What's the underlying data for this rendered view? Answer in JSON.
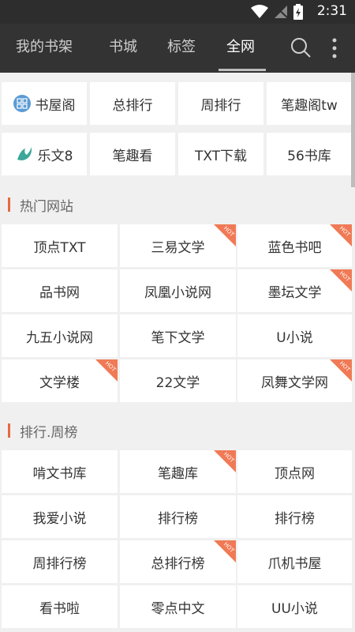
{
  "status_bar": {
    "time": "2:31"
  },
  "tabs": [
    {
      "label": "我的书架"
    },
    {
      "label": "书城"
    },
    {
      "label": "标签"
    },
    {
      "label": "全网"
    }
  ],
  "top_sites": [
    {
      "label": "书屋阁",
      "icon": "grid-circle-icon"
    },
    {
      "label": "总排行"
    },
    {
      "label": "周排行"
    },
    {
      "label": "笔趣阁tw"
    },
    {
      "label": "乐文8",
      "icon": "bird-icon"
    },
    {
      "label": "笔趣看"
    },
    {
      "label": "TXT下载"
    },
    {
      "label": "56书库"
    }
  ],
  "hot_sites": {
    "title": "热门网站",
    "items": [
      {
        "label": "顶点TXT",
        "hot": false
      },
      {
        "label": "三易文学",
        "hot": true
      },
      {
        "label": "蓝色书吧",
        "hot": true
      },
      {
        "label": "品书网",
        "hot": false
      },
      {
        "label": "凤凰小说网",
        "hot": false
      },
      {
        "label": "墨坛文学",
        "hot": true
      },
      {
        "label": "九五小说网",
        "hot": false
      },
      {
        "label": "笔下文学",
        "hot": false
      },
      {
        "label": "U小说",
        "hot": false
      },
      {
        "label": "文学楼",
        "hot": true
      },
      {
        "label": "22文学",
        "hot": false
      },
      {
        "label": "凤舞文学网",
        "hot": true
      }
    ]
  },
  "rank_sites": {
    "title": "排行.周榜",
    "items": [
      {
        "label": "啃文书库",
        "hot": false
      },
      {
        "label": "笔趣库",
        "hot": true
      },
      {
        "label": "顶点网",
        "hot": false
      },
      {
        "label": "我爱小说",
        "hot": false
      },
      {
        "label": "排行榜",
        "hot": false
      },
      {
        "label": "排行榜",
        "hot": false
      },
      {
        "label": "周排行榜",
        "hot": false
      },
      {
        "label": "总排行榜",
        "hot": true
      },
      {
        "label": "爪机书屋",
        "hot": false
      },
      {
        "label": "看书啦",
        "hot": false
      },
      {
        "label": "零点中文",
        "hot": false
      },
      {
        "label": "UU小说",
        "hot": false
      }
    ]
  },
  "hot_badge": {
    "text": "HOT",
    "color": "#f07a55"
  }
}
